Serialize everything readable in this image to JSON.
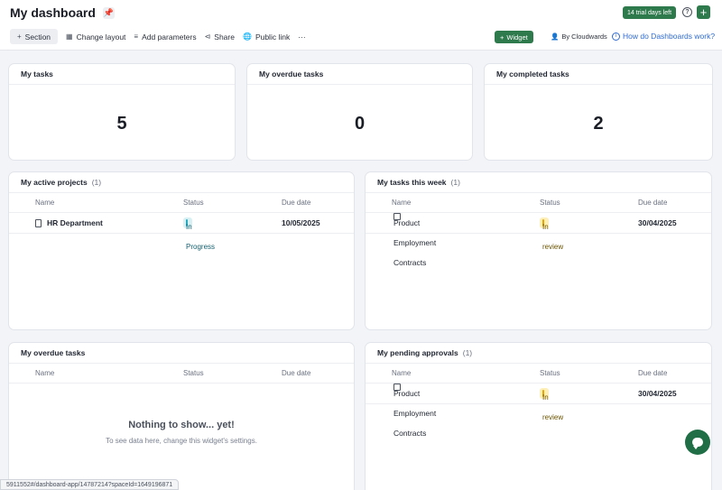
{
  "header": {
    "title": "My dashboard",
    "trial_badge": "14 trial days left",
    "help_glyph": "?",
    "add_glyph": "+"
  },
  "toolbar": {
    "section": "Section",
    "change_layout": "Change layout",
    "add_parameters": "Add parameters",
    "share": "Share",
    "public_link": "Public link",
    "more": "···",
    "widget": "Widget",
    "by": "By Cloudwards",
    "how": "How do Dashboards work?"
  },
  "stats": [
    {
      "title": "My tasks",
      "value": "5"
    },
    {
      "title": "My overdue tasks",
      "value": "0"
    },
    {
      "title": "My completed tasks",
      "value": "2"
    }
  ],
  "columns": {
    "name": "Name",
    "status": "Status",
    "due": "Due date"
  },
  "widgets": {
    "active_projects": {
      "title": "My active projects",
      "count": "(1)",
      "rows": [
        {
          "name": "HR Department",
          "status": "In Progress",
          "due": "10/05/2025"
        }
      ]
    },
    "tasks_week": {
      "title": "My tasks this week",
      "count": "(1)",
      "rows": [
        {
          "name": "Product Employment Contracts",
          "status": "In review",
          "due": "30/04/2025"
        }
      ]
    },
    "overdue_tasks": {
      "title": "My overdue tasks",
      "empty_title": "Nothing to show... yet!",
      "empty_sub": "To see data here, change this widget's settings."
    },
    "pending_approvals": {
      "title": "My pending approvals",
      "count": "(1)",
      "rows": [
        {
          "name": "Product Employment Contracts",
          "status": "In review",
          "due": "30/04/2025"
        }
      ]
    }
  },
  "status_url": "5911552#/dashboard-app/14787214?spaceId=1649196871",
  "colors": {
    "accent": "#2f7a4d",
    "link": "#2f6bd0",
    "in_progress": "#2aa9bf",
    "in_review": "#e6a700"
  }
}
